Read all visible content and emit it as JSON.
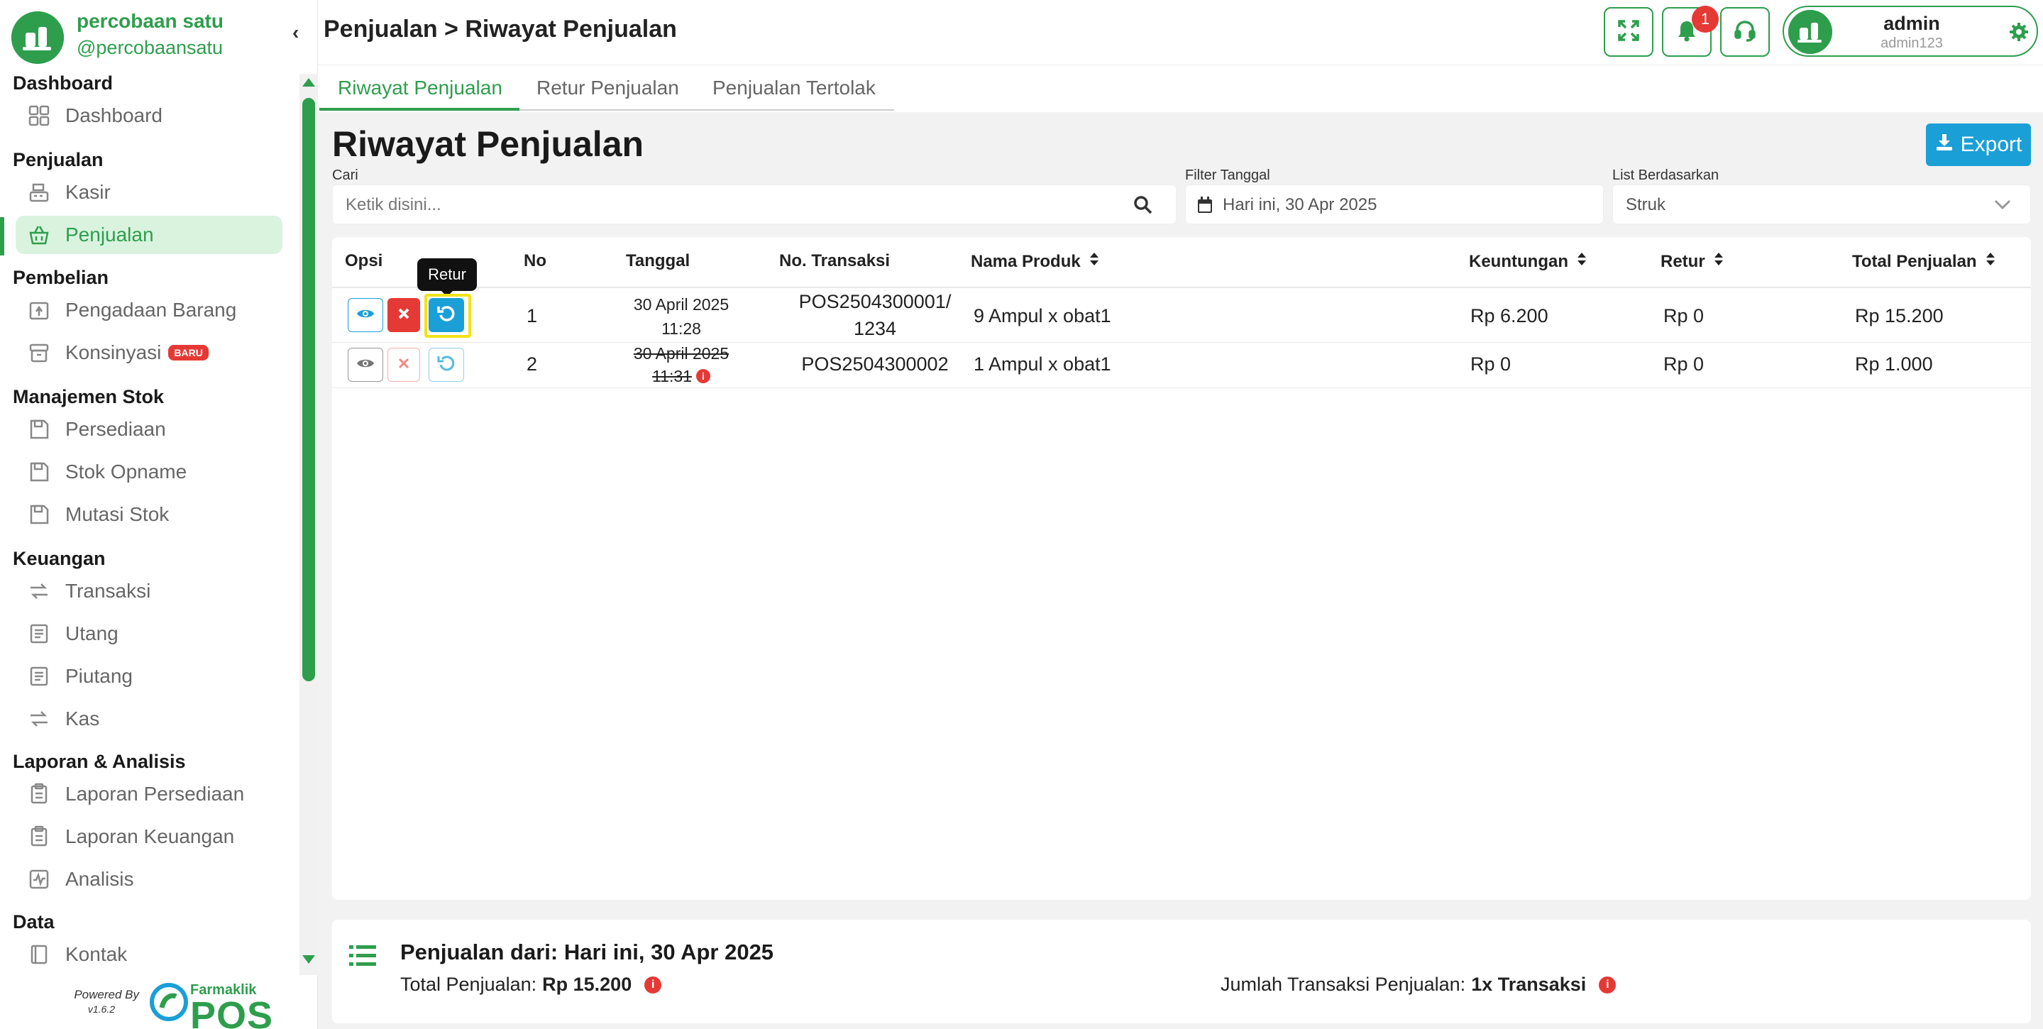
{
  "brand": {
    "name": "percobaan satu",
    "handle": "@percobaansatu"
  },
  "sidebar": {
    "sections": [
      {
        "title": "Dashboard",
        "items": [
          {
            "label": "Dashboard",
            "icon": "grid-icon"
          }
        ]
      },
      {
        "title": "Penjualan",
        "items": [
          {
            "label": "Kasir",
            "icon": "cash-register-icon"
          },
          {
            "label": "Penjualan",
            "icon": "basket-icon",
            "active": true
          }
        ]
      },
      {
        "title": "Pembelian",
        "items": [
          {
            "label": "Pengadaan Barang",
            "icon": "box-in-icon"
          },
          {
            "label": "Konsinyasi",
            "icon": "archive-icon",
            "badge": "BARU"
          }
        ]
      },
      {
        "title": "Manajemen Stok",
        "items": [
          {
            "label": "Persediaan",
            "icon": "floppy-icon"
          },
          {
            "label": "Stok Opname",
            "icon": "floppy-icon"
          },
          {
            "label": "Mutasi Stok",
            "icon": "floppy-icon"
          }
        ]
      },
      {
        "title": "Keuangan",
        "items": [
          {
            "label": "Transaksi",
            "icon": "exchange-icon"
          },
          {
            "label": "Utang",
            "icon": "receipt-icon"
          },
          {
            "label": "Piutang",
            "icon": "receipt-icon"
          },
          {
            "label": "Kas",
            "icon": "exchange-icon"
          }
        ]
      },
      {
        "title": "Laporan & Analisis",
        "items": [
          {
            "label": "Laporan Persediaan",
            "icon": "clipboard-icon"
          },
          {
            "label": "Laporan Keuangan",
            "icon": "clipboard-icon"
          },
          {
            "label": "Analisis",
            "icon": "chart-line-icon"
          }
        ]
      },
      {
        "title": "Data",
        "items": [
          {
            "label": "Kontak",
            "icon": "contact-book-icon"
          }
        ]
      }
    ],
    "powered_by": "Powered By",
    "version": "v1.6.2",
    "logo_small": "Farmaklik",
    "logo_big": "POS"
  },
  "header": {
    "breadcrumb": "Penjualan > Riwayat Penjualan",
    "notification_count": "1",
    "user_name": "admin",
    "user_sub": "admin123"
  },
  "tabs": [
    "Riwayat Penjualan",
    "Retur Penjualan",
    "Penjualan Tertolak"
  ],
  "page": {
    "title": "Riwayat Penjualan",
    "export_label": "Export",
    "filters": {
      "search_label": "Cari",
      "search_placeholder": "Ketik disini...",
      "date_label": "Filter Tanggal",
      "date_value": "Hari ini, 30 Apr 2025",
      "list_label": "List Berdasarkan",
      "list_value": "Struk"
    }
  },
  "table": {
    "headers": {
      "opsi": "Opsi",
      "no": "No",
      "tanggal": "Tanggal",
      "no_transaksi": "No. Transaksi",
      "nama_produk": "Nama Produk",
      "keuntungan": "Keuntungan",
      "retur": "Retur",
      "total": "Total Penjualan"
    },
    "tooltip": "Retur",
    "rows": [
      {
        "no": "1",
        "date": "30 April 2025",
        "time": "11:28",
        "trx_line1": "POS2504300001/",
        "trx_line2": "1234",
        "product": "9 Ampul x obat1",
        "profit": "Rp 6.200",
        "retur": "Rp 0",
        "total": "Rp 15.200",
        "cancelled": false
      },
      {
        "no": "2",
        "date": "30 April 2025",
        "time": "11:31",
        "trx_line1": "POS2504300002",
        "trx_line2": "",
        "product": "1 Ampul x obat1",
        "profit": "Rp 0",
        "retur": "Rp 0",
        "total": "Rp 1.000",
        "cancelled": true
      }
    ]
  },
  "summary": {
    "title": "Penjualan dari: Hari ini, 30 Apr 2025",
    "total_label": "Total Penjualan:",
    "total_value": "Rp 15.200",
    "count_label": "Jumlah Transaksi Penjualan:",
    "count_value": "1x Transaksi"
  },
  "colors": {
    "primary": "#2e9e4d",
    "accent_blue": "#1a9fd6",
    "danger": "#e53935",
    "highlight": "#f2e21a"
  }
}
